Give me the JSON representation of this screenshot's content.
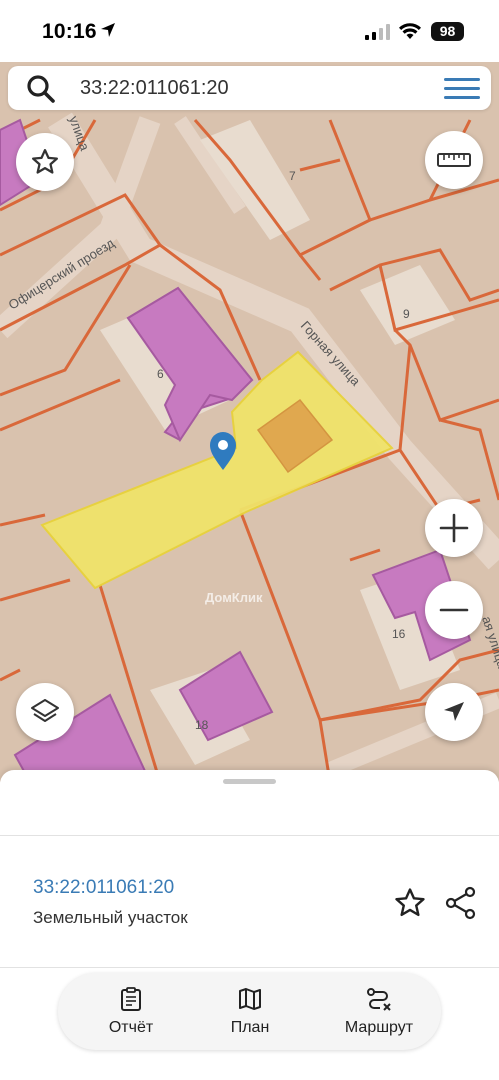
{
  "status_bar": {
    "time": "10:16",
    "battery": "98"
  },
  "search": {
    "query": "33:22:011061:20"
  },
  "map": {
    "street_labels": [
      "Офицерский проезд",
      "Горная улица",
      "ая улица",
      "улица"
    ],
    "house_numbers": [
      "7",
      "9",
      "6",
      "16",
      "18"
    ],
    "watermark": "ДомКлик"
  },
  "parcel": {
    "cadastral_number": "33:22:011061:20",
    "type": "Земельный участок"
  },
  "bottom_nav": {
    "items": [
      {
        "label": "Отчёт",
        "icon": "report-icon"
      },
      {
        "label": "План",
        "icon": "map-plan-icon"
      },
      {
        "label": "Маршрут",
        "icon": "route-icon"
      }
    ]
  },
  "colors": {
    "accent": "#3a7bb5",
    "map_background": "#d9c2ae",
    "parcel_fill": "#f0e36a",
    "building_fill": "#c77ac0",
    "boundary": "#d9683a"
  }
}
